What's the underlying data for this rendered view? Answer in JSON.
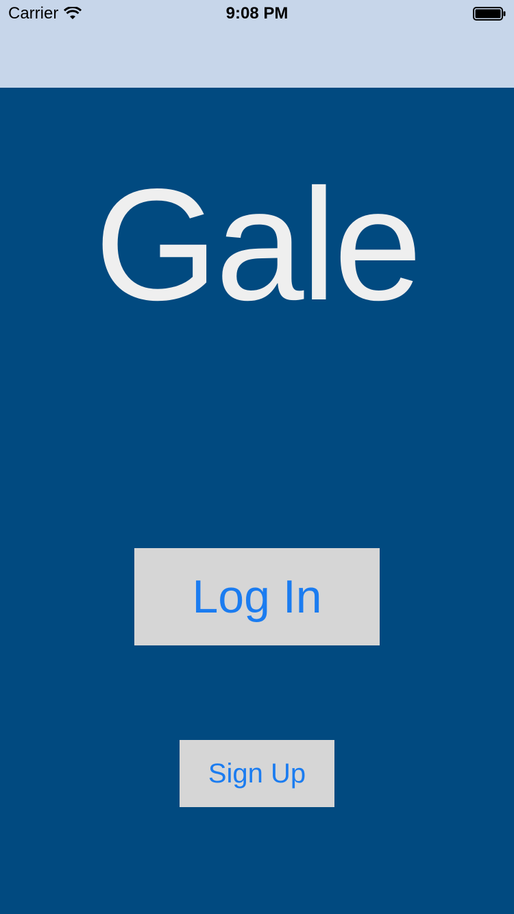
{
  "status_bar": {
    "carrier": "Carrier",
    "time": "9:08 PM",
    "wifi_icon": "wifi-icon",
    "battery_icon": "battery-full-icon"
  },
  "app": {
    "title": "Gale",
    "background_color": "#014a80",
    "header_color": "#c7d6ea"
  },
  "actions": {
    "login_label": "Log In",
    "signup_label": "Sign Up",
    "button_text_color": "#1b7cf0",
    "button_background": "#d6d6d6"
  }
}
